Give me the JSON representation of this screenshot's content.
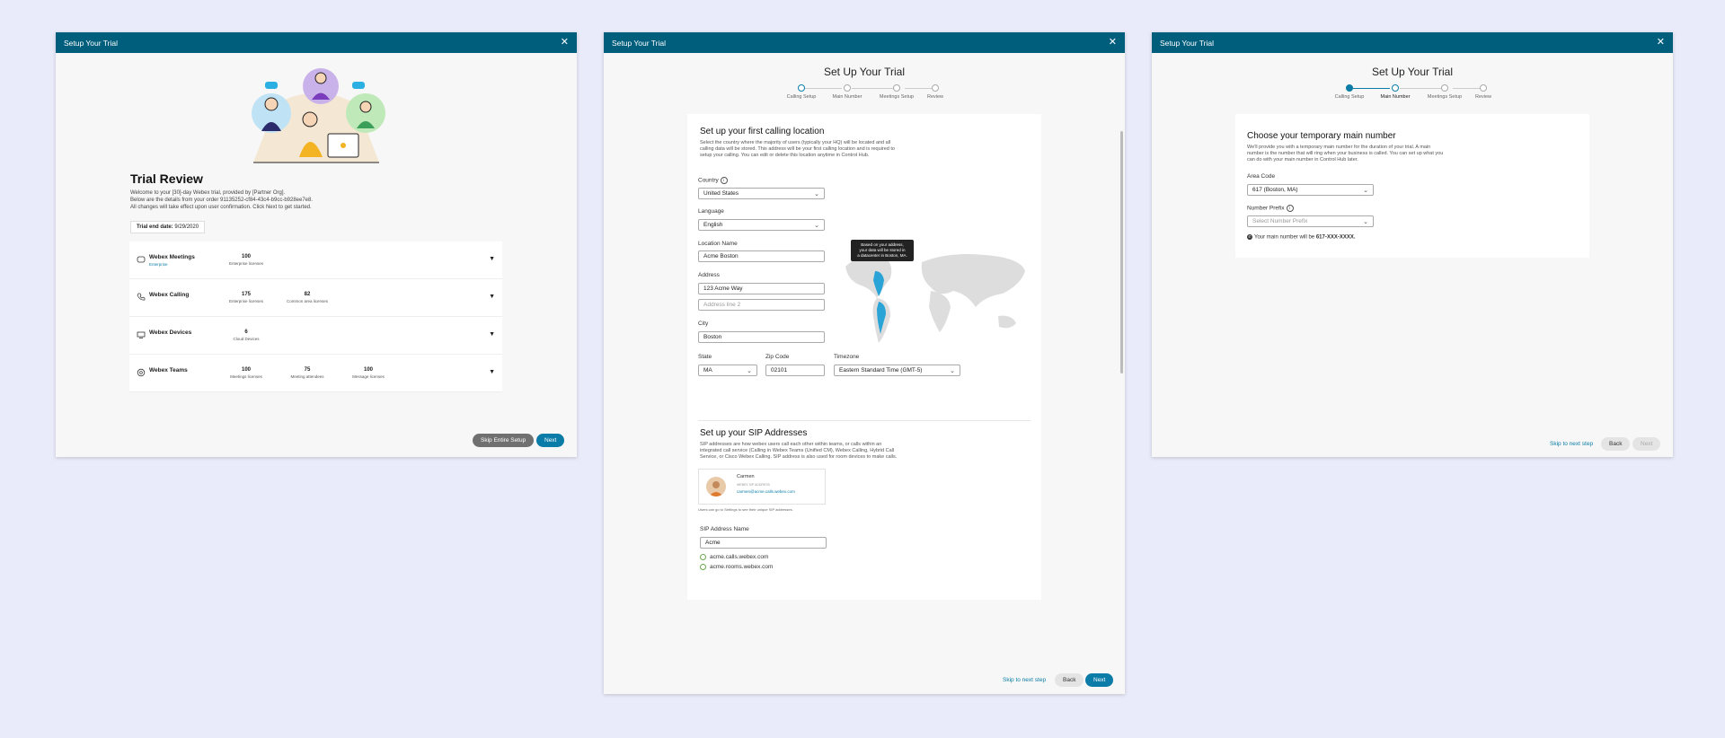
{
  "modal1": {
    "header_title": "Setup Your Trial",
    "title": "Trial Review",
    "intro_lines": [
      "Welcome to your [30]-day Webex trial, provided by [Partner Org].",
      "Below are the details from your order 91135252-cf84-43c4-b9cc-b928ee7e8.",
      "All changes will take effect upon user confirmation. Click Next to get started."
    ],
    "trial_end_label": "Trial end date:",
    "trial_end_value": "9/29/2020",
    "services": [
      {
        "name": "Webex Meetings",
        "sub": "Enterprise",
        "icon": "meetings-icon",
        "licenses": [
          {
            "num": "100",
            "label": "Enterprise licenses"
          }
        ]
      },
      {
        "name": "Webex Calling",
        "sub": "",
        "icon": "phone-icon",
        "licenses": [
          {
            "num": "175",
            "label": "Enterprise licenses"
          },
          {
            "num": "82",
            "label": "Common area licenses"
          }
        ]
      },
      {
        "name": "Webex Devices",
        "sub": "",
        "icon": "device-icon",
        "licenses": [
          {
            "num": "6",
            "label": "Cloud Devices"
          }
        ]
      },
      {
        "name": "Webex Teams",
        "sub": "",
        "icon": "teams-icon",
        "licenses": [
          {
            "num": "100",
            "label": "Meetings licenses"
          },
          {
            "num": "75",
            "label": "Meeting attendees"
          },
          {
            "num": "100",
            "label": "Message licenses"
          }
        ]
      }
    ],
    "skip_label": "Skip Entire Setup",
    "next_label": "Next"
  },
  "modal2": {
    "header_title": "Setup Your Trial",
    "title": "Set Up Your Trial",
    "steps": [
      "Calling Setup",
      "Main Number",
      "Meetings Setup",
      "Review"
    ],
    "section1_title": "Set up your first calling location",
    "section1_desc": [
      "Select the country where the majority of users (typically your HQ) will be located and all",
      "calling data will be stored. This address will be your first calling location and is required to",
      "setup your calling. You can edit or delete this location anytime in Control Hub."
    ],
    "country_label": "Country",
    "country_value": "United States",
    "language_label": "Language",
    "language_value": "English",
    "location_label": "Location Name",
    "location_value": "Acme Boston",
    "address_label": "Address",
    "address1_value": "123 Acme Way",
    "address2_placeholder": "Address line 2",
    "city_label": "City",
    "city_value": "Boston",
    "state_label": "State",
    "state_value": "MA",
    "zip_label": "Zip Code",
    "zip_value": "02101",
    "timezone_label": "Timezone",
    "timezone_value": "Eastern Standard Time (GMT-5)",
    "map_tooltip": [
      "Based on your address,",
      "your data will be stored in",
      "a datacenter in Boston, MA."
    ],
    "section2_title": "Set up your SIP Addresses",
    "section2_desc": [
      "SIP addresses are how webex users call each other within teams, or calls within an",
      "integrated call service (Calling in Webex Teams (Unified CM), Webex Calling, Hybrid Call",
      "Service, or Cisco Webex Calling. SIP address is also used for room devices to make calls."
    ],
    "sip_card_name": "Carmen",
    "sip_card_label": "WEBEX SIP ADDRESS",
    "sip_card_address": "carmen@acme.calls.webex.com",
    "sip_note": "Users can go to Settings to see their unique SIP addresses.",
    "sip_name_label": "SIP Address Name",
    "sip_name_value": "Acme",
    "sip_domains": [
      "acme.calls.webex.com",
      "acme.rooms.webex.com"
    ],
    "skip_label": "Skip to next step",
    "back_label": "Back",
    "next_label": "Next"
  },
  "modal3": {
    "header_title": "Setup Your Trial",
    "title": "Set Up Your Trial",
    "steps": [
      "Calling Setup",
      "Main Number",
      "Meetings Setup",
      "Review"
    ],
    "section_title": "Choose your temporary main number",
    "section_desc": [
      "We'll provide you with a temporary main number for the duration of your trial. A main",
      "number is the number that will ring when your business is called. You can set up what you",
      "can do with your main number in Control Hub later."
    ],
    "area_label": "Area Code",
    "area_value": "617 (Boston, MA)",
    "prefix_label": "Number Prefix",
    "prefix_placeholder": "Select Number Prefix",
    "main_number_prefix": "Your main number will be ",
    "main_number_value": "617-XXX-XXXX.",
    "skip_label": "Skip to next step",
    "back_label": "Back",
    "next_label": "Next"
  },
  "colors": {
    "header": "#005e7d",
    "accent": "#0b7ca8",
    "page_bg": "#e9ebfa"
  }
}
